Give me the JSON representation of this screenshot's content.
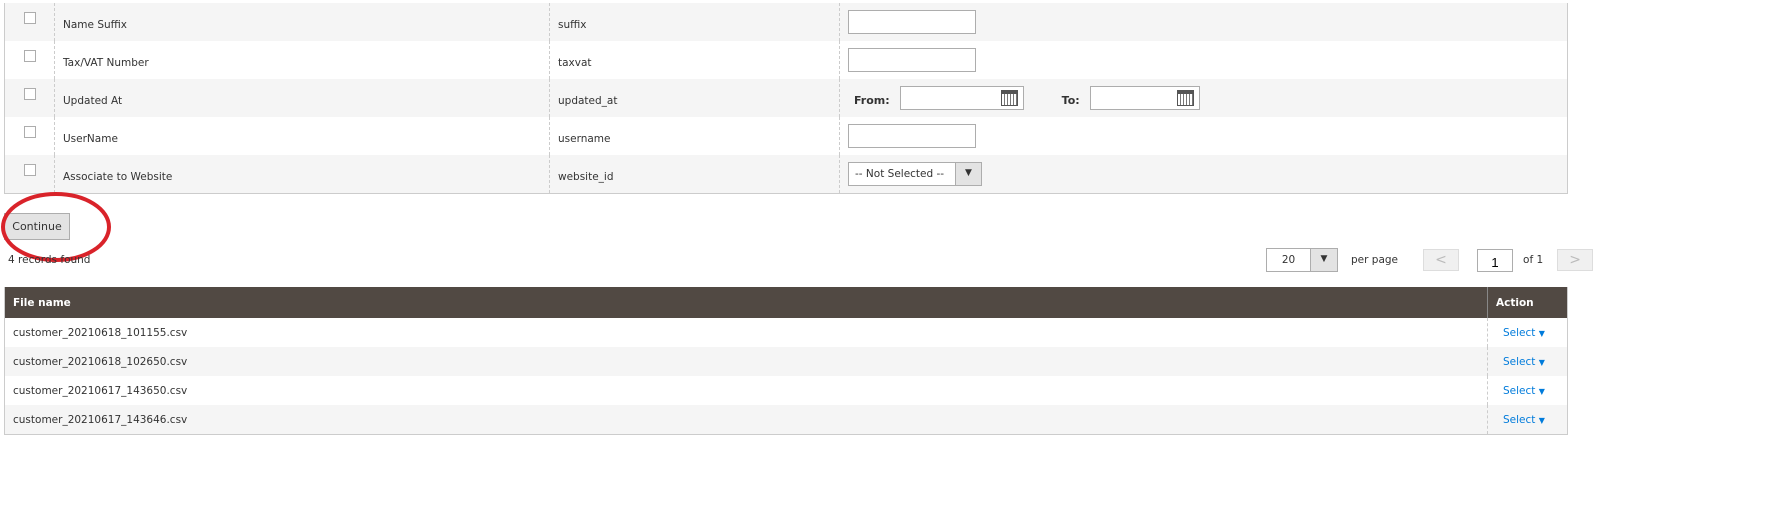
{
  "attributes": [
    {
      "label": "Name Suffix",
      "code": "suffix",
      "filter": "text"
    },
    {
      "label": "Tax/VAT Number",
      "code": "taxvat",
      "filter": "text"
    },
    {
      "label": "Updated At",
      "code": "updated_at",
      "filter": "date"
    },
    {
      "label": "UserName",
      "code": "username",
      "filter": "text"
    },
    {
      "label": "Associate to Website",
      "code": "website_id",
      "filter": "select"
    }
  ],
  "date_filter": {
    "from_label": "From:",
    "to_label": "To:"
  },
  "website_select": {
    "value": "-- Not Selected --"
  },
  "continue_label": "Continue",
  "records_found": "4 records found",
  "pager": {
    "per_page_value": "20",
    "per_page_label": "per page",
    "page": "1",
    "of_label": "of 1",
    "prev": "<",
    "next": ">"
  },
  "files_table": {
    "headers": {
      "file": "File name",
      "action": "Action"
    },
    "rows": [
      {
        "file": "customer_20210618_101155.csv",
        "action": "Select"
      },
      {
        "file": "customer_20210618_102650.csv",
        "action": "Select"
      },
      {
        "file": "customer_20210617_143650.csv",
        "action": "Select"
      },
      {
        "file": "customer_20210617_143646.csv",
        "action": "Select"
      }
    ]
  },
  "annotation_color": "#d9232a",
  "link_color": "#007bdb"
}
